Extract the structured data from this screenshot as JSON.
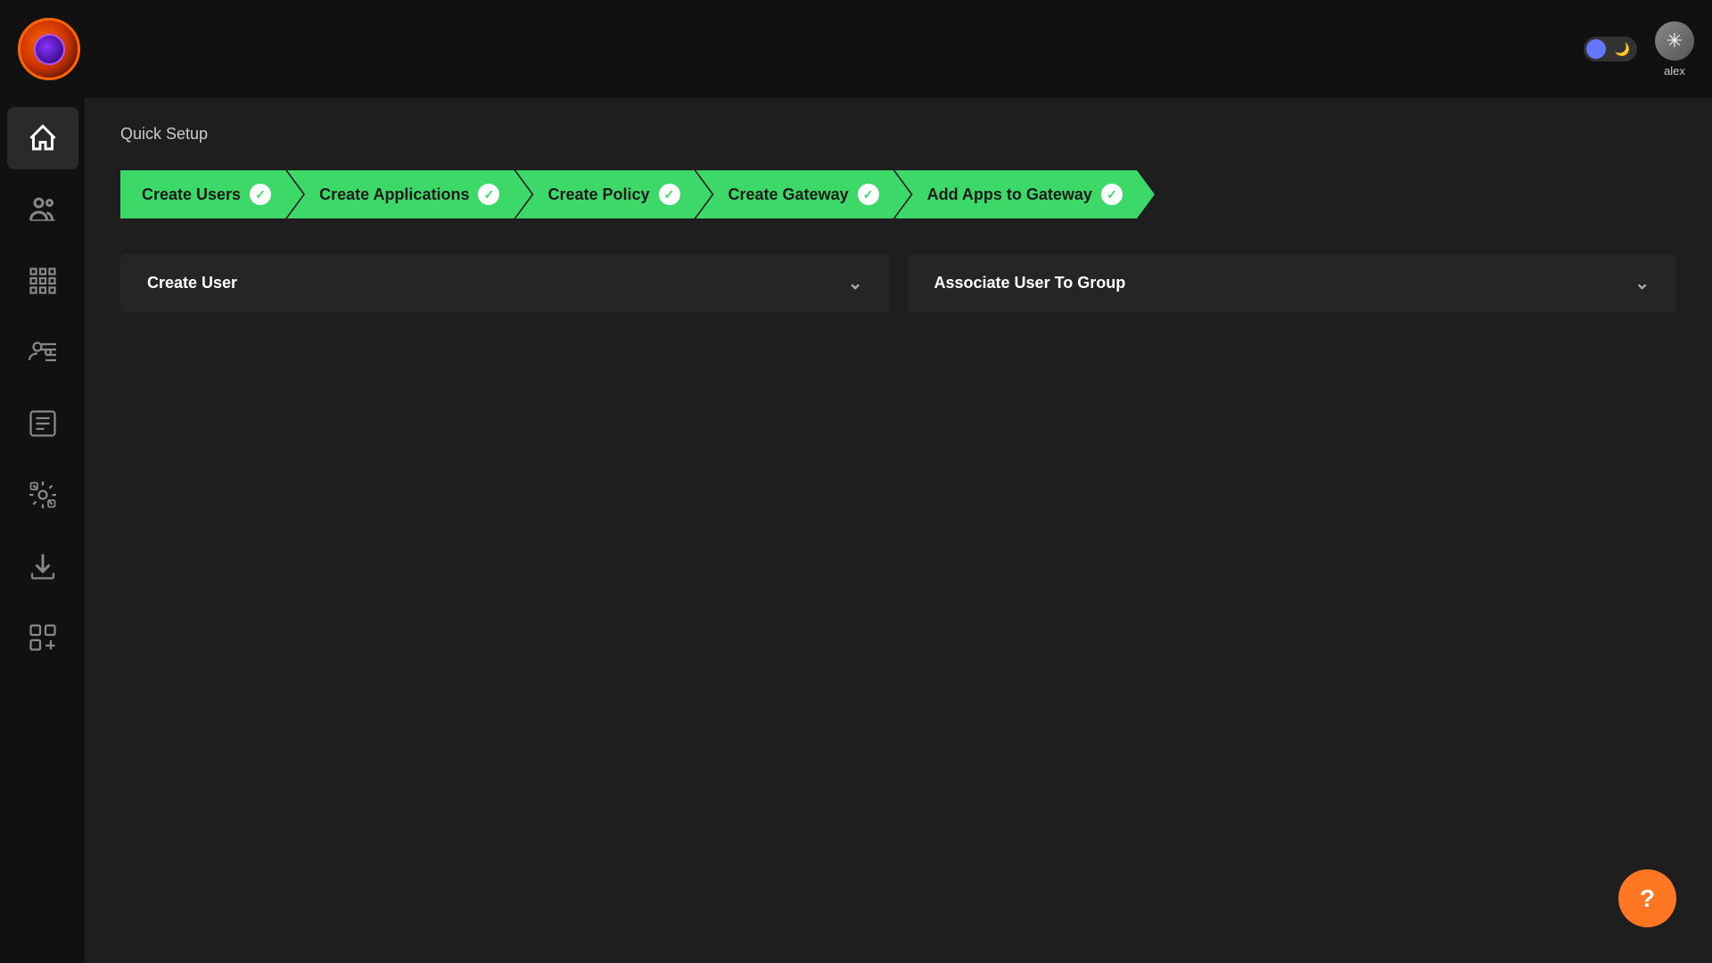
{
  "topbar": {
    "username": "alex"
  },
  "sidebar": {
    "items": [
      {
        "id": "home",
        "label": "Home",
        "active": true
      },
      {
        "id": "users",
        "label": "Users",
        "active": false
      },
      {
        "id": "grid",
        "label": "Grid",
        "active": false
      },
      {
        "id": "identity",
        "label": "Identity",
        "active": false
      },
      {
        "id": "logs",
        "label": "Logs",
        "active": false
      },
      {
        "id": "settings",
        "label": "Settings",
        "active": false
      },
      {
        "id": "download",
        "label": "Download",
        "active": false
      },
      {
        "id": "apps",
        "label": "Apps",
        "active": false
      }
    ]
  },
  "quickSetup": {
    "title": "Quick Setup",
    "steps": [
      {
        "id": "create-users",
        "label": "Create Users",
        "completed": true,
        "first": true
      },
      {
        "id": "create-applications",
        "label": "Create Applications",
        "completed": true
      },
      {
        "id": "create-policy",
        "label": "Create Policy",
        "completed": true
      },
      {
        "id": "create-gateway",
        "label": "Create Gateway",
        "completed": true
      },
      {
        "id": "add-apps",
        "label": "Add Apps to Gateway",
        "completed": true
      }
    ]
  },
  "panels": [
    {
      "id": "create-user",
      "label": "Create User",
      "expanded": false
    },
    {
      "id": "associate-user",
      "label": "Associate User To Group",
      "expanded": false
    }
  ],
  "toggle": {
    "mode": "dark"
  },
  "help": {
    "label": "?"
  }
}
